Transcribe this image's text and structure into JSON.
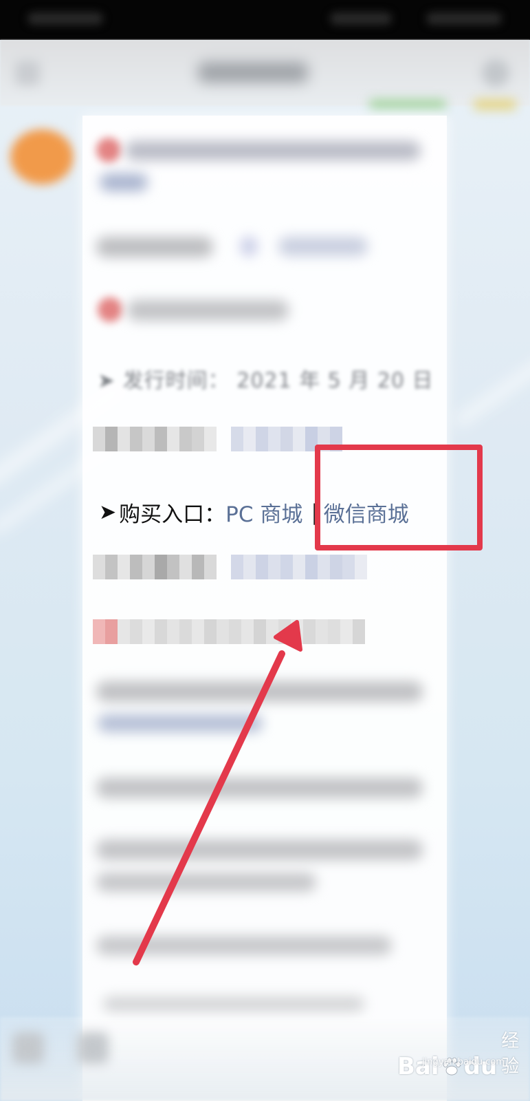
{
  "colors": {
    "link": "#5a7096",
    "annotation": "#e3394b",
    "avatar": "#f19a4a"
  },
  "release_line": {
    "arrow": "➤",
    "label": "发行时间：",
    "value": "2021 年 5 月 20 日"
  },
  "purchase_row": {
    "arrow": "➤",
    "label": "购买入口：",
    "pc_link": "PC 商城",
    "separator": "|",
    "wechat_link": "微信商城"
  },
  "watermark": {
    "brand_left": "Bai",
    "brand_right": "du",
    "product": "经验",
    "domain": "jingyan.baidu.com"
  },
  "icons": [
    "back-icon",
    "more-icon",
    "paw-icon"
  ]
}
